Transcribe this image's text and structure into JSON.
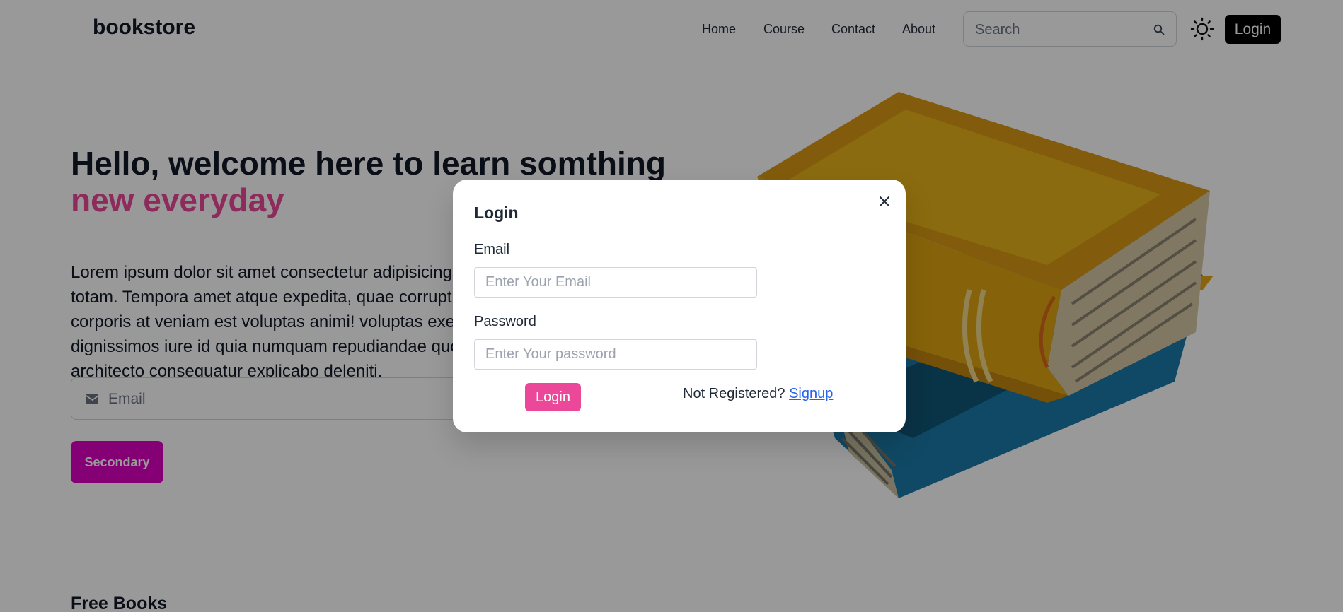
{
  "navbar": {
    "brand": "bookstore",
    "links": [
      "Home",
      "Course",
      "Contact",
      "About"
    ],
    "search_placeholder": "Search",
    "login_label": "Login"
  },
  "hero": {
    "title_line1": "Hello, welcome here to learn somthing",
    "title_line2": "new everyday",
    "paragraph": "Lorem ipsum dolor sit amet consectetur adipisicing elit. Itaque, et totam. Tempora amet atque expedita, quae corrupti totam sed pariatur corporis at veniam est voluptas animi! voluptas exercitationem dignissimos iure id quia numquam repudiandae quod iusto consectetur architecto consequatur explicabo deleniti.",
    "email_placeholder": "Email",
    "secondary_label": "Secondary"
  },
  "section": {
    "free_books_title": "Free Books"
  },
  "modal": {
    "title": "Login",
    "email_label": "Email",
    "email_placeholder": "Enter Your Email",
    "password_label": "Password",
    "password_placeholder": "Enter Your password",
    "login_label": "Login",
    "register_prompt": "Not Registered?",
    "signup_label": "Signup"
  },
  "colors": {
    "accent_pink": "#ec4899",
    "secondary_magenta": "#e000c3",
    "overlay": "rgba(0,0,0,0.4)",
    "book_yellow": "#e8b21a",
    "book_blue": "#1b7aa8"
  },
  "icons": [
    "search-icon",
    "sun-icon",
    "envelope-icon",
    "close-icon"
  ]
}
